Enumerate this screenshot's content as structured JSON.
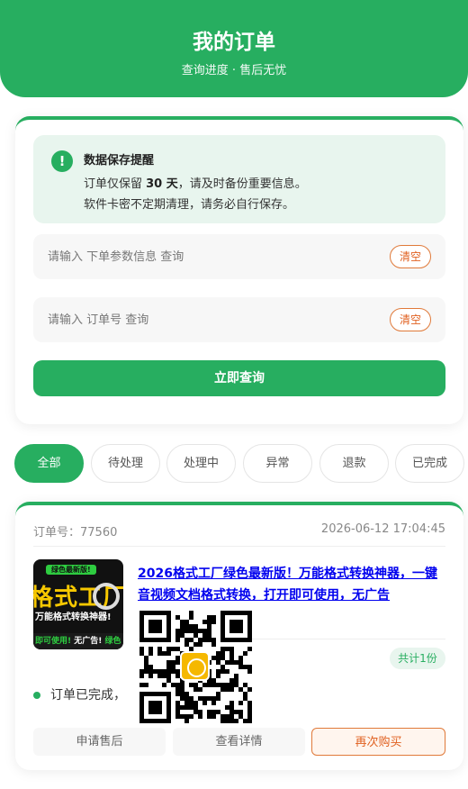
{
  "header": {
    "title": "我的订单",
    "subtitle": "查询进度 · 售后无忧"
  },
  "notice": {
    "icon": "exclamation-icon",
    "title": "数据保存提醒",
    "line1_before": "订单仅保留 ",
    "line1_days": "30 天",
    "line1_after": "，请及时备份重要信息。",
    "line2": "软件卡密不定期清理，请务必自行保存。"
  },
  "search": {
    "params_placeholder": "请输入 下单参数信息 查询",
    "params_value": "",
    "order_placeholder": "请输入 订单号 查询",
    "order_value": "",
    "clear_label": "清空",
    "submit_label": "立即查询"
  },
  "tabs": [
    {
      "label": "全部",
      "active": true
    },
    {
      "label": "待处理",
      "active": false
    },
    {
      "label": "处理中",
      "active": false
    },
    {
      "label": "异常",
      "active": false
    },
    {
      "label": "退款",
      "active": false
    },
    {
      "label": "已完成",
      "active": false
    }
  ],
  "order": {
    "order_no_label": "订单号：77560",
    "time": "2026-06-12 17:04:45",
    "product_title": "2026格式工厂绿色最新版！万能格式转换神器，一键音视频文档格式转换，打开即可使用，无广告",
    "thumbnail": {
      "tag": "绿色最新版!",
      "big_text": "格式工厂",
      "sub_text": "万能格式转换神器!",
      "foot_text_left": "即可使用!",
      "foot_text_mid": "无广告!",
      "foot_text_right": "绿色"
    },
    "count_label": "共计1份",
    "status_text": "订单已完成，",
    "actions": {
      "after_sale": "申请售后",
      "details": "查看详情",
      "rebuy": "再次购买"
    }
  },
  "colors": {
    "brand_green": "#27ae60",
    "accent_orange": "#e06020",
    "qr_logo": "#f5b800"
  },
  "qr_overlay": {
    "icon": "qr-code-icon"
  }
}
